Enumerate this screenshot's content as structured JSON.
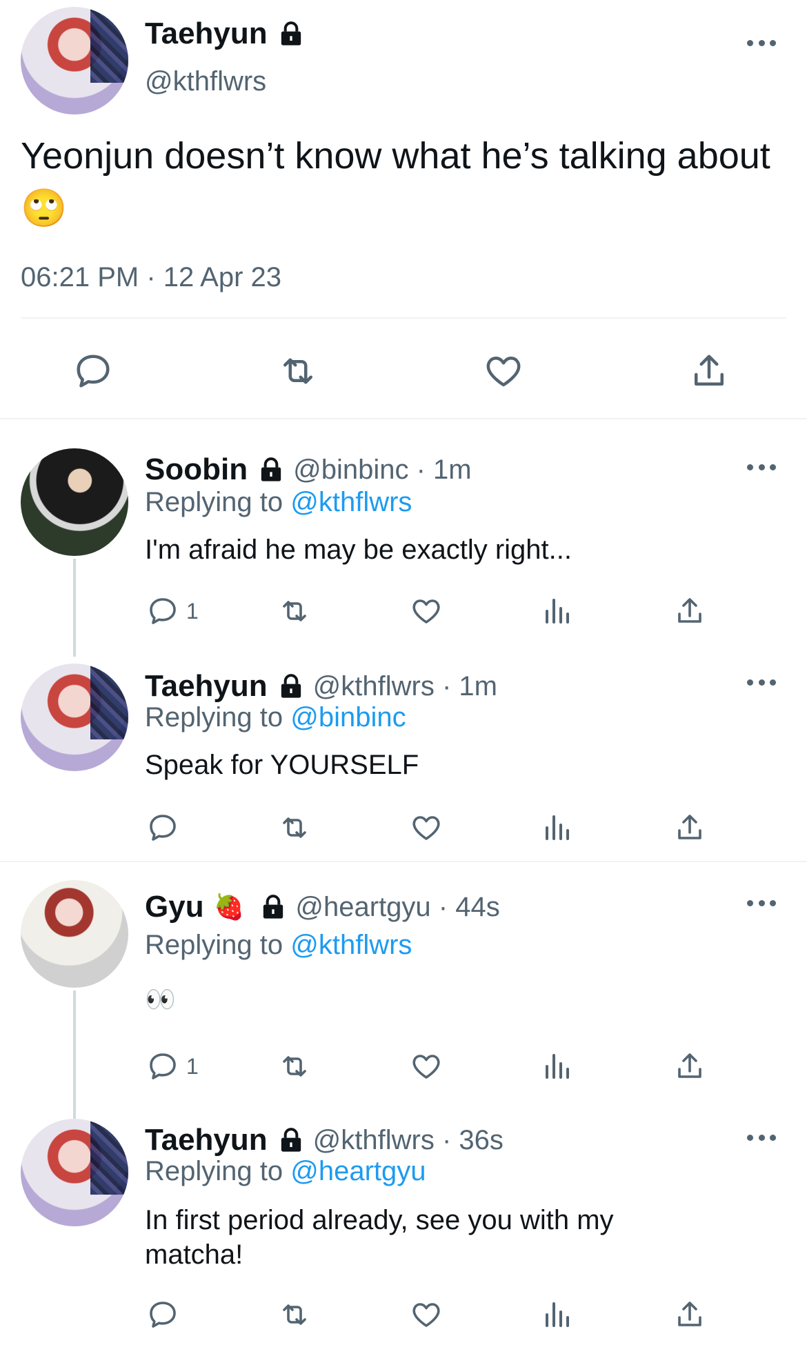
{
  "main_tweet": {
    "name": "Taehyun",
    "handle": "@kthflwrs",
    "text": "Yeonjun doesn’t know what he’s talking about",
    "emoji": "🙄",
    "timestamp": "06:21 PM · 12 Apr 23"
  },
  "replies": [
    {
      "name": "Soobin",
      "meta": "@binbinc · 1m",
      "replying_prefix": "Replying to ",
      "replying_to": "@kthflwrs",
      "text": "I'm afraid he may be exactly right...",
      "reply_count": "1"
    },
    {
      "name": "Taehyun",
      "meta": "@kthflwrs · 1m",
      "replying_prefix": "Replying to ",
      "replying_to": "@binbinc",
      "text": "Speak for YOURSELF",
      "reply_count": ""
    },
    {
      "name": "Gyu",
      "name_emoji": "🍓",
      "meta": "@heartgyu · 44s",
      "replying_prefix": "Replying to ",
      "replying_to": "@kthflwrs",
      "text": "👀",
      "reply_count": "1"
    },
    {
      "name": "Taehyun",
      "meta": "@kthflwrs · 36s",
      "replying_prefix": "Replying to ",
      "replying_to": "@heartgyu",
      "text_line1": "In first period already, see you with my",
      "text_line2": "matcha!",
      "reply_count": ""
    }
  ],
  "colors": {
    "accent": "#1d9bf0",
    "secondary_text": "#536471",
    "divider": "#eff3f4"
  }
}
